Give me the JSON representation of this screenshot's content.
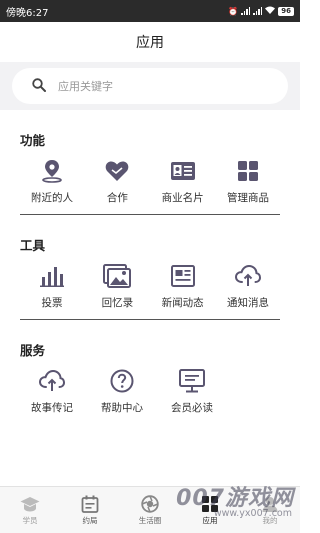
{
  "status": {
    "time": "傍晚6:27",
    "battery": "96"
  },
  "header": {
    "title": "应用"
  },
  "search": {
    "placeholder": "应用关键字"
  },
  "sections": [
    {
      "title": "功能",
      "items": [
        {
          "label": "附近的人",
          "icon": "location-pin-icon"
        },
        {
          "label": "合作",
          "icon": "handshake-heart-icon"
        },
        {
          "label": "商业名片",
          "icon": "business-card-icon"
        },
        {
          "label": "管理商品",
          "icon": "grid-apps-icon"
        }
      ]
    },
    {
      "title": "工具",
      "items": [
        {
          "label": "投票",
          "icon": "bar-chart-icon"
        },
        {
          "label": "回忆录",
          "icon": "photo-album-icon"
        },
        {
          "label": "新闻动态",
          "icon": "newspaper-icon"
        },
        {
          "label": "通知消息",
          "icon": "cloud-upload-icon"
        }
      ]
    },
    {
      "title": "服务",
      "items": [
        {
          "label": "故事传记",
          "icon": "cloud-upload-icon"
        },
        {
          "label": "帮助中心",
          "icon": "question-circle-icon"
        },
        {
          "label": "会员必读",
          "icon": "monitor-icon"
        }
      ]
    }
  ],
  "tabbar": [
    {
      "label": "学员",
      "icon": "graduation-cap-icon"
    },
    {
      "label": "约局",
      "icon": "calendar-icon"
    },
    {
      "label": "生活圈",
      "icon": "aperture-icon"
    },
    {
      "label": "应用",
      "icon": "apps-icon",
      "active": true
    },
    {
      "label": "我的",
      "icon": "user-icon"
    }
  ],
  "watermark": {
    "brand": "007游戏网",
    "url": "www.yx007.com"
  },
  "colors": {
    "icon": "#5a5570",
    "status_bg": "#2b2b2b",
    "search_bg": "#f2f2f4"
  }
}
